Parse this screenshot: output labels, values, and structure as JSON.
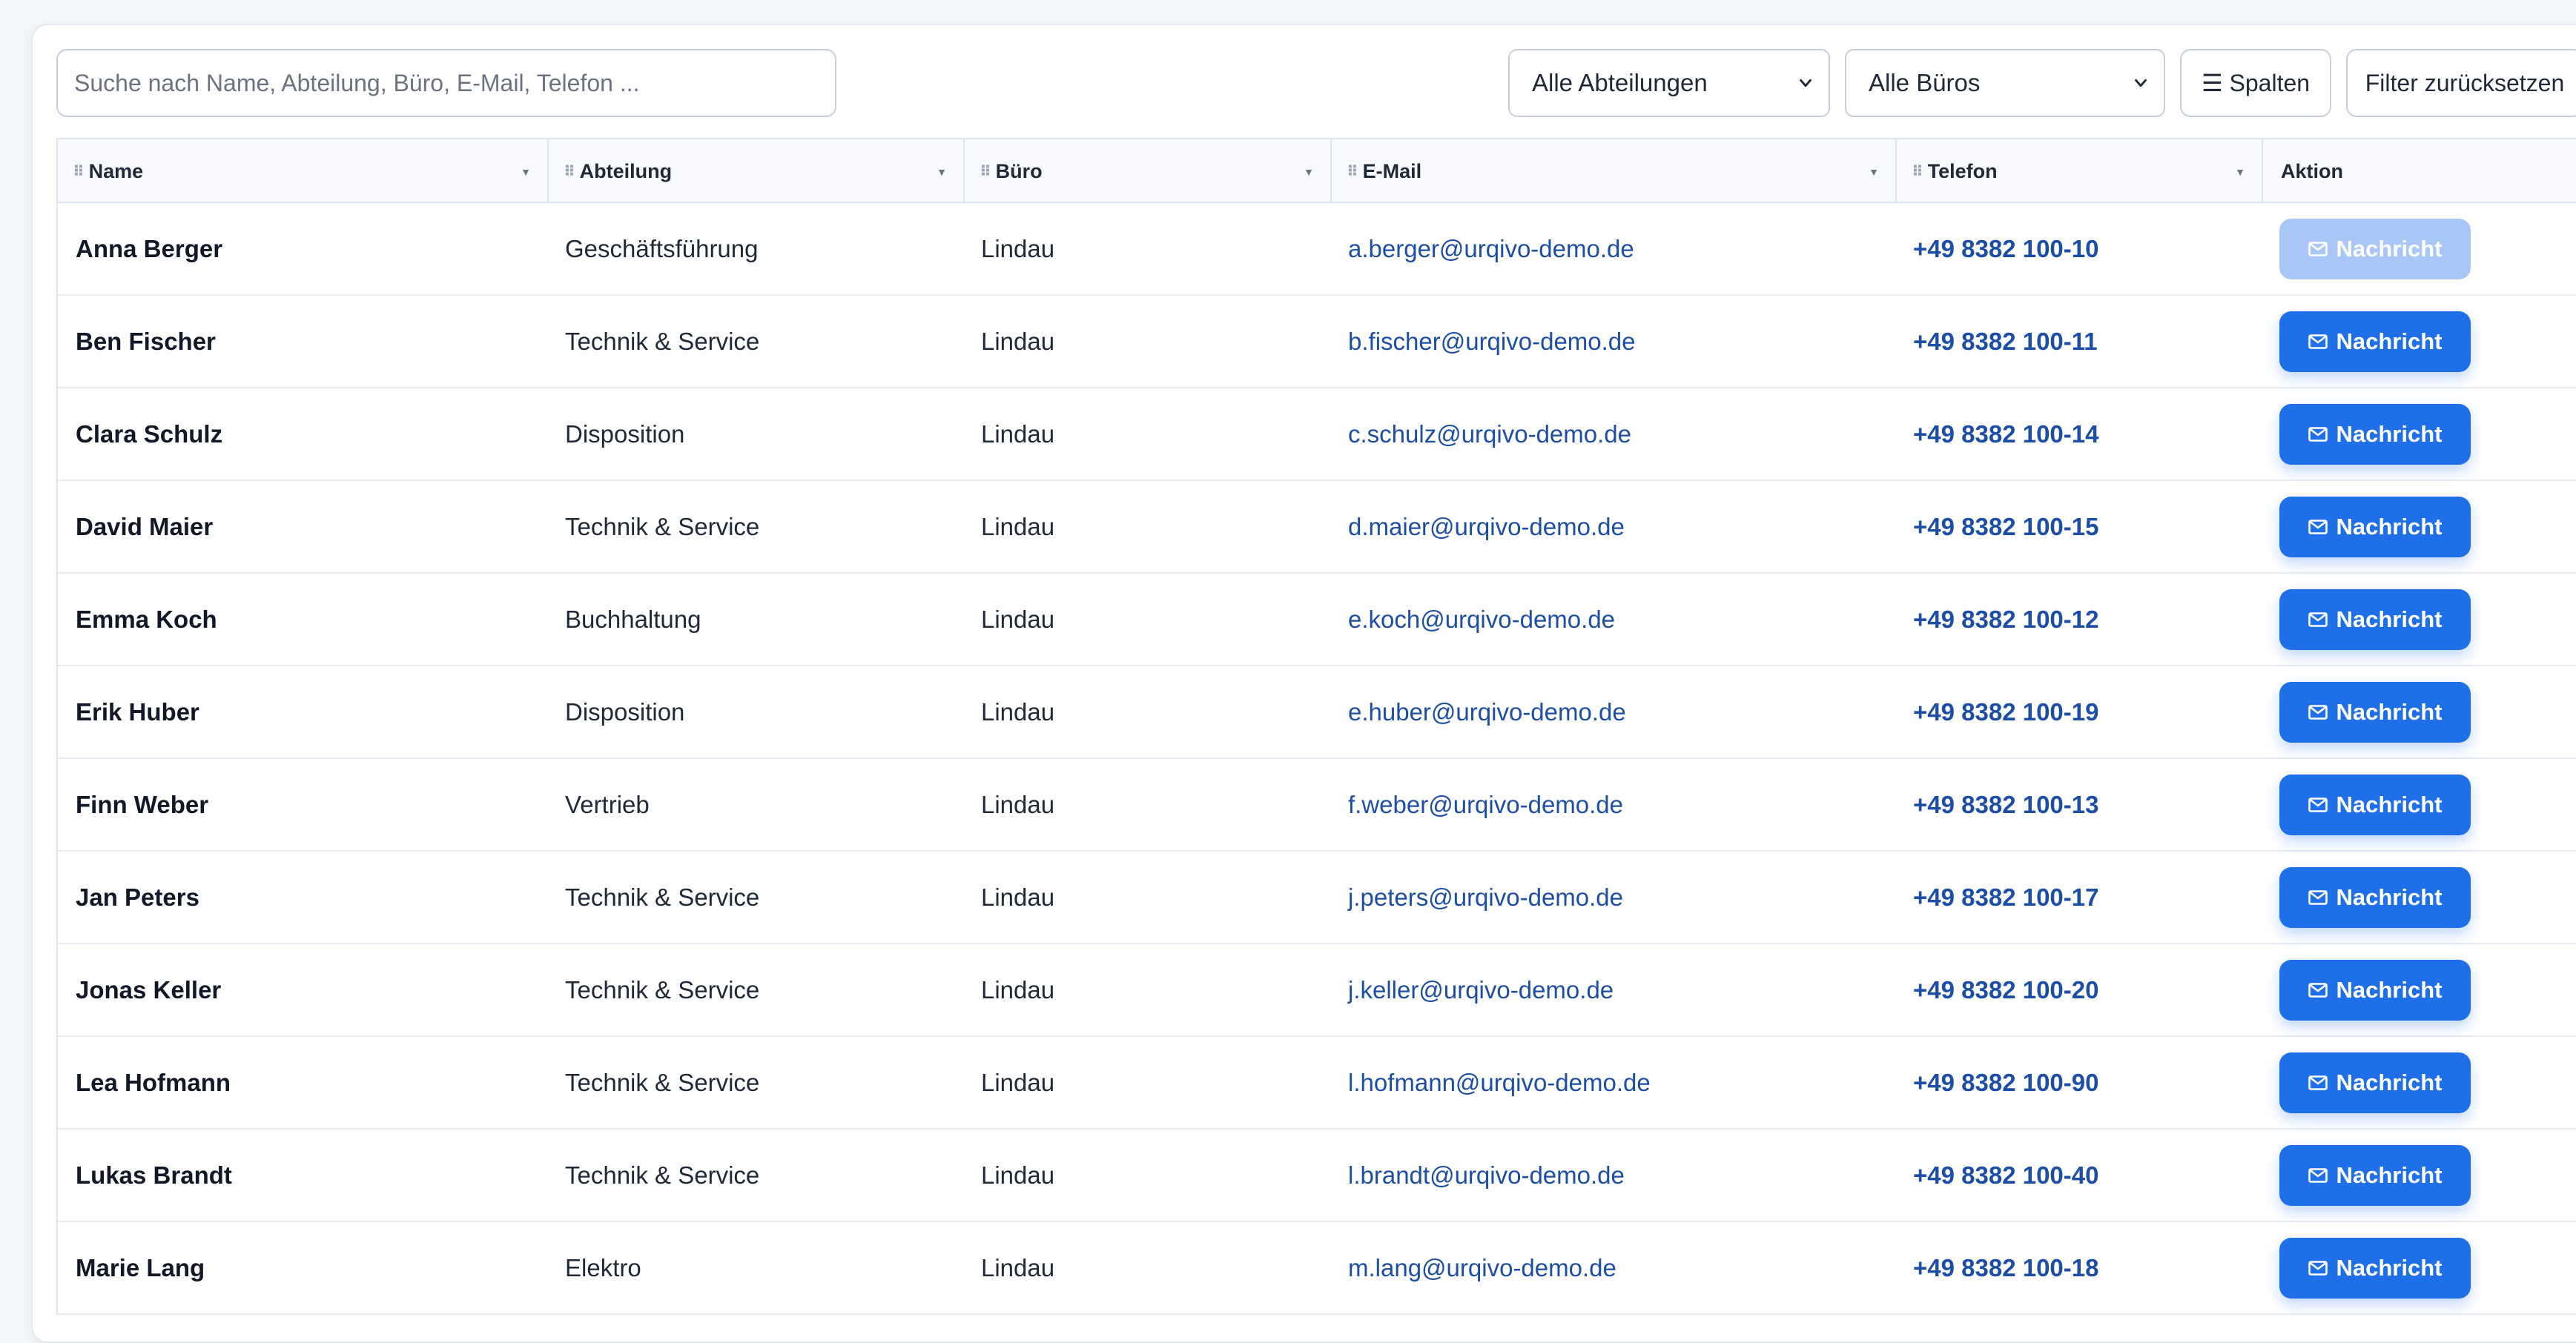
{
  "toolbar": {
    "search_placeholder": "Suche nach Name, Abteilung, Büro, E-Mail, Telefon ...",
    "department_select": "Alle Abteilungen",
    "office_select": "Alle Büros",
    "columns_button": "☰ Spalten",
    "reset_button": "Filter zurücksetzen"
  },
  "table": {
    "headers": [
      "Name",
      "Abteilung",
      "Büro",
      "E-Mail",
      "Telefon",
      "Aktion"
    ],
    "action_label": "Nachricht",
    "rows": [
      {
        "name": "Anna Berger",
        "department": "Geschäftsführung",
        "office": "Lindau",
        "email": "a.berger@urqivo-demo.de",
        "phone": "+49 8382 100-10",
        "action_disabled": true
      },
      {
        "name": "Ben Fischer",
        "department": "Technik & Service",
        "office": "Lindau",
        "email": "b.fischer@urqivo-demo.de",
        "phone": "+49 8382 100-11",
        "action_disabled": false
      },
      {
        "name": "Clara Schulz",
        "department": "Disposition",
        "office": "Lindau",
        "email": "c.schulz@urqivo-demo.de",
        "phone": "+49 8382 100-14",
        "action_disabled": false
      },
      {
        "name": "David Maier",
        "department": "Technik & Service",
        "office": "Lindau",
        "email": "d.maier@urqivo-demo.de",
        "phone": "+49 8382 100-15",
        "action_disabled": false
      },
      {
        "name": "Emma Koch",
        "department": "Buchhaltung",
        "office": "Lindau",
        "email": "e.koch@urqivo-demo.de",
        "phone": "+49 8382 100-12",
        "action_disabled": false
      },
      {
        "name": "Erik Huber",
        "department": "Disposition",
        "office": "Lindau",
        "email": "e.huber@urqivo-demo.de",
        "phone": "+49 8382 100-19",
        "action_disabled": false
      },
      {
        "name": "Finn Weber",
        "department": "Vertrieb",
        "office": "Lindau",
        "email": "f.weber@urqivo-demo.de",
        "phone": "+49 8382 100-13",
        "action_disabled": false
      },
      {
        "name": "Jan Peters",
        "department": "Technik & Service",
        "office": "Lindau",
        "email": "j.peters@urqivo-demo.de",
        "phone": "+49 8382 100-17",
        "action_disabled": false
      },
      {
        "name": "Jonas Keller",
        "department": "Technik & Service",
        "office": "Lindau",
        "email": "j.keller@urqivo-demo.de",
        "phone": "+49 8382 100-20",
        "action_disabled": false
      },
      {
        "name": "Lea Hofmann",
        "department": "Technik & Service",
        "office": "Lindau",
        "email": "l.hofmann@urqivo-demo.de",
        "phone": "+49 8382 100-90",
        "action_disabled": false
      },
      {
        "name": "Lukas Brandt",
        "department": "Technik & Service",
        "office": "Lindau",
        "email": "l.brandt@urqivo-demo.de",
        "phone": "+49 8382 100-40",
        "action_disabled": false
      },
      {
        "name": "Marie Lang",
        "department": "Elektro",
        "office": "Lindau",
        "email": "m.lang@urqivo-demo.de",
        "phone": "+49 8382 100-18",
        "action_disabled": false
      }
    ]
  },
  "colors": {
    "accent": "#1f6fe8",
    "accent_disabled": "#a9c7f6",
    "link": "#1d4ea6"
  },
  "icons": {
    "message_icon": "envelope-icon",
    "sort_icon": "sort-caret-icon",
    "drag_icon": "drag-handle-icon",
    "select_icon": "chevron-down-icon"
  }
}
